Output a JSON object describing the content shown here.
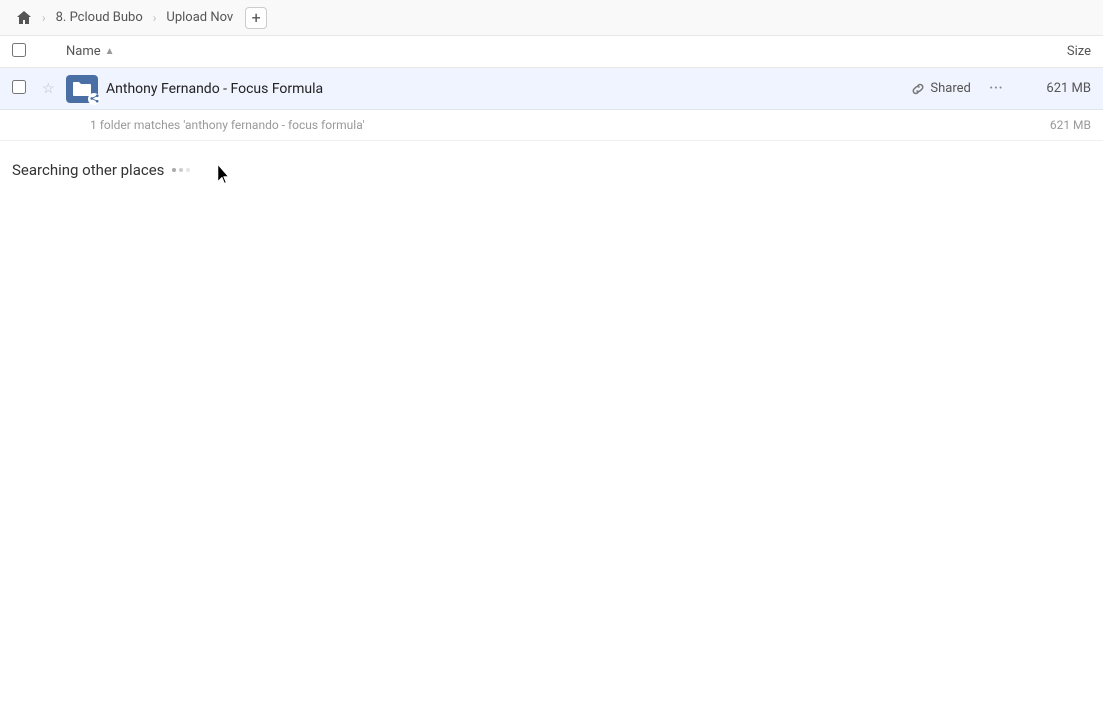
{
  "breadcrumb": {
    "home_icon": "🏠",
    "items": [
      {
        "label": "8. Pcloud Bubo"
      },
      {
        "label": "Upload Nov"
      }
    ],
    "add_icon": "+"
  },
  "columns": {
    "name_label": "Name",
    "sort_indicator": "▲",
    "size_label": "Size"
  },
  "file_row": {
    "name": "Anthony Fernando - Focus Formula",
    "shared_label": "Shared",
    "size": "621 MB"
  },
  "summary": {
    "text": "1 folder matches 'anthony fernando - focus formula'",
    "size": "621 MB"
  },
  "searching": {
    "label": "Searching other places"
  }
}
